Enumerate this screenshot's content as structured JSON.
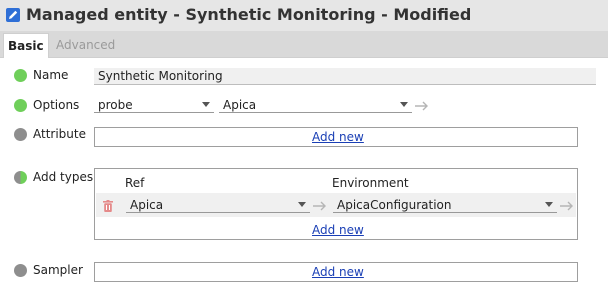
{
  "window": {
    "title": "Managed entity - Synthetic Monitoring - Modified",
    "icon": "edit-icon"
  },
  "tabs": [
    {
      "label": "Basic",
      "active": true
    },
    {
      "label": "Advanced",
      "active": false
    }
  ],
  "fields": {
    "name": {
      "label": "Name",
      "value": "Synthetic Monitoring",
      "status": "green"
    },
    "options": {
      "label": "Options",
      "select1": "probe",
      "select2": "Apica",
      "status": "green"
    },
    "attribute": {
      "label": "Attribute",
      "add_new": "Add new",
      "status": "gray"
    },
    "add_types": {
      "label": "Add types",
      "status": "half",
      "columns": {
        "ref": "Ref",
        "environment": "Environment"
      },
      "rows": [
        {
          "ref": "Apica",
          "environment": "ApicaConfiguration"
        }
      ],
      "add_new": "Add new"
    },
    "sampler": {
      "label": "Sampler",
      "add_new": "Add new",
      "status": "gray"
    }
  },
  "colors": {
    "status_green": "#6fcf5a",
    "status_gray": "#8e8e8e",
    "link": "#1a3fb5",
    "delete_icon": "#e58a8a"
  }
}
